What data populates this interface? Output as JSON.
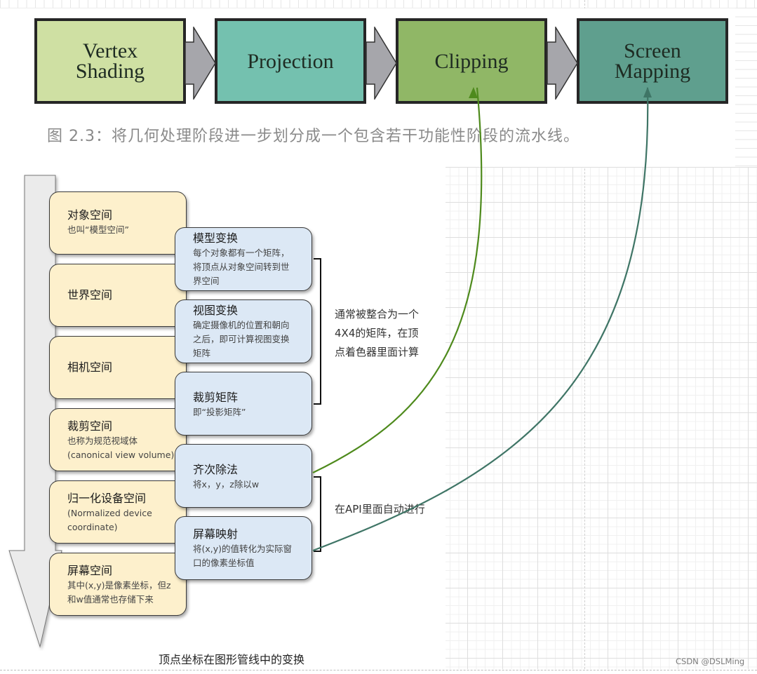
{
  "pipeline": {
    "stages": [
      {
        "label_lines": [
          "Vertex",
          "Shading"
        ],
        "color": "#cfe0a3"
      },
      {
        "label_lines": [
          "Projection"
        ],
        "color": "#74c1af"
      },
      {
        "label_lines": [
          "Clipping"
        ],
        "color": "#90b766"
      },
      {
        "label_lines": [
          "Screen",
          "Mapping"
        ],
        "color": "#5f9f8e"
      }
    ],
    "arrow_color": "#a6a6ab",
    "caption": "图 2.3：将几何处理阶段进一步划分成一个包含若干功能性阶段的流水线。"
  },
  "spaces": [
    {
      "title": "对象空间",
      "desc": "也叫“模型空间”"
    },
    {
      "title": "世界空间",
      "desc": ""
    },
    {
      "title": "相机空间",
      "desc": ""
    },
    {
      "title": "裁剪空间",
      "desc": "也称为规范视域体\n(canonical view volume)"
    },
    {
      "title": "归一化设备空间",
      "desc": "(Normalized device\ncoordinate)"
    },
    {
      "title": "屏幕空间",
      "desc": "其中(x,y)是像素坐标，但z\n和w值通常也存储下来"
    }
  ],
  "transforms": [
    {
      "title": "模型变换",
      "desc": "每个对象都有一个矩阵，\n将顶点从对象空间转到世\n界空间"
    },
    {
      "title": "视图变换",
      "desc": "确定摄像机的位置和朝向\n之后，即可计算视图变换\n矩阵"
    },
    {
      "title": "裁剪矩阵",
      "desc": "即“投影矩阵”"
    },
    {
      "title": "齐次除法",
      "desc": "将x，y，z除以w"
    },
    {
      "title": "屏幕映射",
      "desc": "将(x,y)的值转化为实际窗\n口的像素坐标值"
    }
  ],
  "notes": {
    "matrix_note": "通常被整合为一个\n4X4的矩阵，在顶\n点着色器里面计算",
    "api_note": "在API里面自动进行"
  },
  "connectors": [
    {
      "from": "齐次除法",
      "to": "Clipping",
      "color": "#4e8a1c"
    },
    {
      "from": "屏幕映射",
      "to": "Screen Mapping",
      "color": "#3f7566"
    }
  ],
  "caption": "顶点坐标在图形管线中的变换",
  "watermark": "CSDN @DSLMing"
}
